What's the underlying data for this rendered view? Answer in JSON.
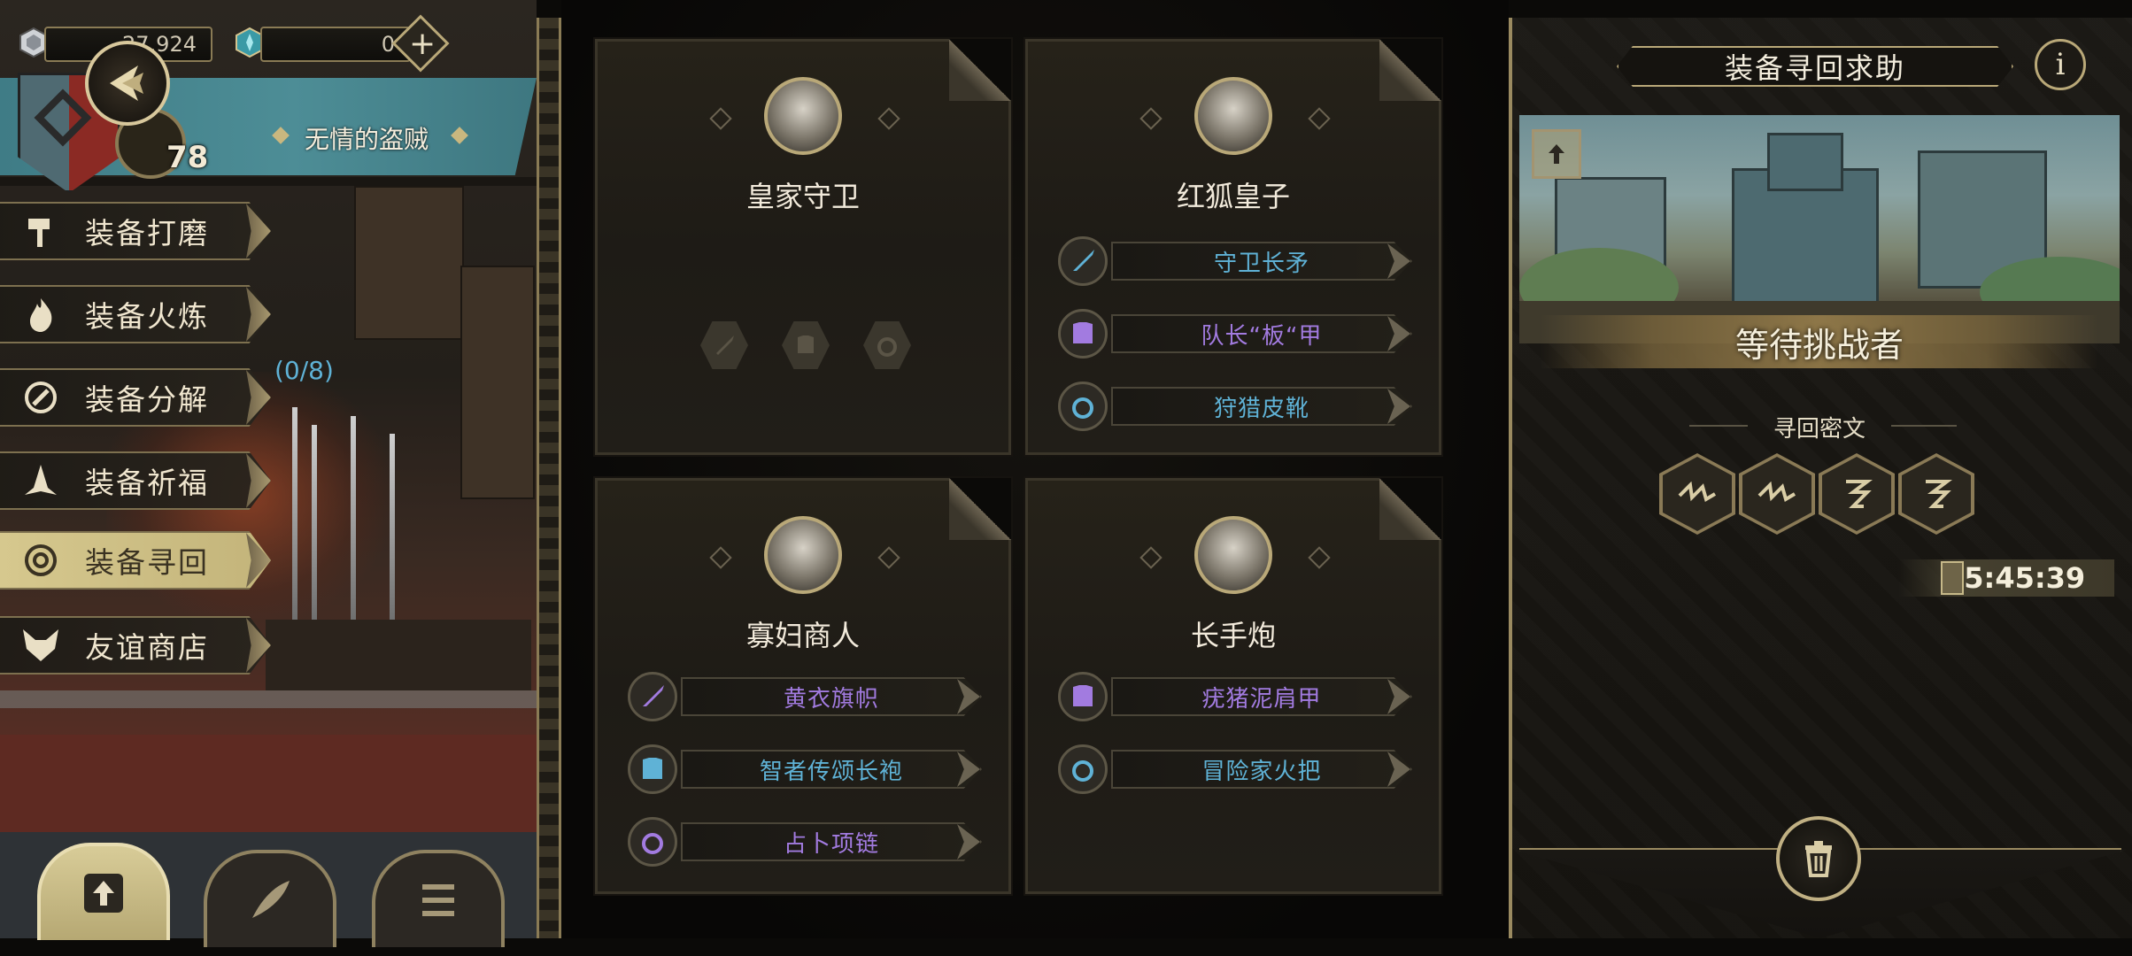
{
  "currency": {
    "silver": "27,924",
    "gems": "0"
  },
  "profile": {
    "level": "78",
    "title": "无情的盗贼"
  },
  "menu": {
    "items": [
      {
        "label": "装备打磨"
      },
      {
        "label": "装备火炼"
      },
      {
        "label": "装备分解"
      },
      {
        "label": "装备祈福"
      },
      {
        "label": "装备寻回"
      },
      {
        "label": "友谊商店"
      }
    ],
    "active": "装备寻回",
    "progress_count": "(0/8)"
  },
  "cards": [
    {
      "name": "皇家守卫",
      "equipment": [],
      "empty_slots": [
        "sword-slot",
        "armor-slot",
        "ring-slot"
      ]
    },
    {
      "name": "红狐皇子",
      "equipment": [
        {
          "name": "守卫长矛",
          "type": "sword",
          "color": "#5fb2d6"
        },
        {
          "name": "队长“板“甲",
          "type": "armor",
          "color": "#a27be0"
        },
        {
          "name": "狩猎皮靴",
          "type": "ring",
          "color": "#5fb2d6"
        }
      ]
    },
    {
      "name": "寡妇商人",
      "equipment": [
        {
          "name": "黄衣旗帜",
          "type": "sword",
          "color": "#a27be0"
        },
        {
          "name": "智者传颂长袍",
          "type": "armor",
          "color": "#5fb2d6"
        },
        {
          "name": "占卜项链",
          "type": "ring",
          "color": "#a27be0"
        }
      ]
    },
    {
      "name": "长手炮",
      "equipment": [
        {
          "name": "疣猪泥肩甲",
          "type": "armor",
          "color": "#a27be0"
        },
        {
          "name": "冒险家火把",
          "type": "ring",
          "color": "#5fb2d6"
        }
      ]
    }
  ],
  "right_panel": {
    "title": "装备寻回求助",
    "info": "i",
    "status": "等待挑战者",
    "cipher_label": "寻回密文",
    "timer": "05:45:39"
  },
  "colors": {
    "gold": "#b9a878",
    "rare_blue": "#5fb2d6",
    "epic_purple": "#a27be0"
  }
}
